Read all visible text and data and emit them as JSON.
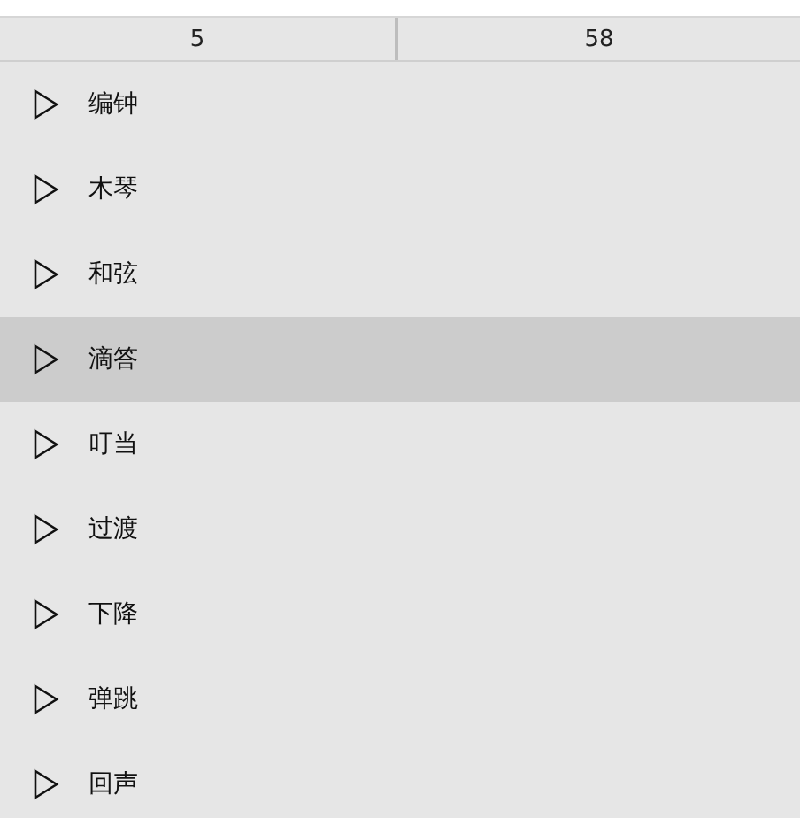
{
  "header": {
    "cells": [
      "5",
      "58"
    ]
  },
  "sounds": [
    {
      "name": "编钟",
      "selected": false
    },
    {
      "name": "木琴",
      "selected": false
    },
    {
      "name": "和弦",
      "selected": false
    },
    {
      "name": "滴答",
      "selected": true
    },
    {
      "name": "叮当",
      "selected": false
    },
    {
      "name": "过渡",
      "selected": false
    },
    {
      "name": "下降",
      "selected": false
    },
    {
      "name": "弹跳",
      "selected": false
    },
    {
      "name": "回声",
      "selected": false
    }
  ]
}
